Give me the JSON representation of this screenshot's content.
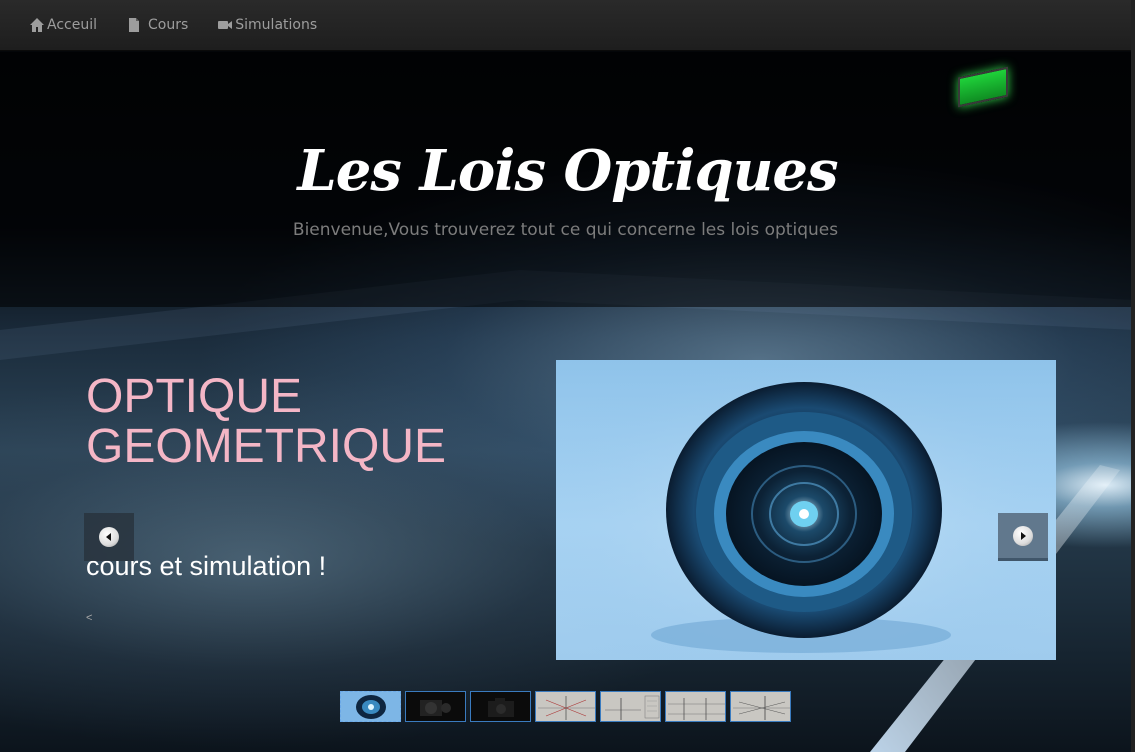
{
  "nav": {
    "items": [
      {
        "label": "Acceuil",
        "icon": "home-icon"
      },
      {
        "label": "Cours",
        "icon": "file-icon"
      },
      {
        "label": "Simulations",
        "icon": "video-camera-icon"
      }
    ]
  },
  "header": {
    "title": "Les Lois Optiques",
    "subtitle": "Bienvenue,Vous trouverez tout ce qui concerne les lois optiques"
  },
  "slider": {
    "heading": "OPTIQUE GEOMETRIQUE",
    "subheading": "cours et simulation !",
    "small_text": "<",
    "prev_icon": "chevron-left-icon",
    "next_icon": "chevron-right-icon",
    "thumbnails": [
      {
        "kind": "lens",
        "active": true
      },
      {
        "kind": "camera",
        "active": false
      },
      {
        "kind": "camera",
        "active": false
      },
      {
        "kind": "diagram",
        "active": false
      },
      {
        "kind": "diagram",
        "active": false
      },
      {
        "kind": "diagram",
        "active": false
      },
      {
        "kind": "diagram",
        "active": false
      }
    ]
  },
  "colors": {
    "navbar_bg": "#222222",
    "nav_text": "#9d9d9d",
    "heading_pink": "#f4b6c6",
    "thumb_border": "#3a7bbf"
  }
}
